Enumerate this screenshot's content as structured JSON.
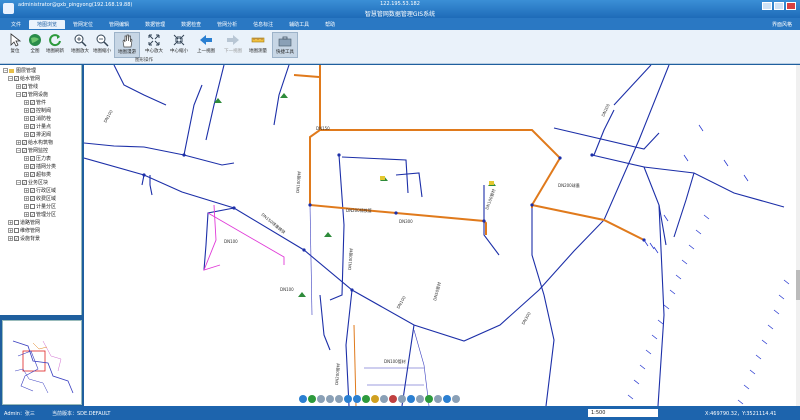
{
  "titlebar": {
    "host": "administrator@gxb_pingyong(192.168.19.88)",
    "ip": "122.195.53.182",
    "app_title": "智慧管网数据管理GIS系统"
  },
  "menu": {
    "items": [
      "文件",
      "地图浏览",
      "管网定位",
      "管网编辑",
      "数据管理",
      "数据检查",
      "管网分析",
      "信息标注",
      "辅助工具",
      "帮助"
    ],
    "active_index": 1,
    "right_label": "界面风格"
  },
  "toolbar": {
    "buttons": [
      "复位",
      "全图",
      "地图刷新",
      "地图放大",
      "地图缩小",
      "地图漫游",
      "中心放大",
      "中心缩小",
      "上一视图",
      "下一视图",
      "地图测量",
      "快捷工具"
    ],
    "group_label": "图形操作"
  },
  "tree": {
    "items": [
      {
        "label": "图层管理",
        "level": 0
      },
      {
        "label": "给水管网",
        "level": 1
      },
      {
        "label": "管线",
        "level": 2
      },
      {
        "label": "管网设施",
        "level": 2
      },
      {
        "label": "管件",
        "level": 3
      },
      {
        "label": "控制阀",
        "level": 3
      },
      {
        "label": "消防栓",
        "level": 3
      },
      {
        "label": "计量点",
        "level": 3
      },
      {
        "label": "排泥阀",
        "level": 3
      },
      {
        "label": "给水构筑物",
        "level": 2
      },
      {
        "label": "管网监控",
        "level": 2
      },
      {
        "label": "压力表",
        "level": 3
      },
      {
        "label": "插网分类",
        "level": 3
      },
      {
        "label": "超标类",
        "level": 3
      },
      {
        "label": "业务区块",
        "level": 2
      },
      {
        "label": "行政区域",
        "level": 3
      },
      {
        "label": "收费区域",
        "level": 3
      },
      {
        "label": "计量分区",
        "level": 3
      },
      {
        "label": "管理分区",
        "level": 3
      },
      {
        "label": "道路管网",
        "level": 1
      },
      {
        "label": "维修管网",
        "level": 1
      },
      {
        "label": "设施背景",
        "level": 1
      }
    ]
  },
  "map_labels": {
    "pipe_labels": [
      "DN100",
      "DN100管材",
      "DN200铸铁管",
      "DN150",
      "DN300",
      "DN100管材",
      "DN200球墨",
      "DN100管材",
      "DN150球墨铸铁",
      "DN100",
      "DN200",
      "DN100管材",
      "DN100",
      "DN200管材",
      "DN300",
      "DN50管材",
      "DN100"
    ]
  },
  "statusbar": {
    "user": "Admin：张三",
    "version": "当前版本：SDE.DEFAULT",
    "scale": "1:500",
    "coords": "X:469790.32，Y:3521114.41"
  },
  "colors": {
    "accent": "#1e6bb8",
    "pipe_main": "#1c2fa8",
    "pipe_orange": "#e07a1c",
    "pipe_magenta": "#e03bd8"
  }
}
